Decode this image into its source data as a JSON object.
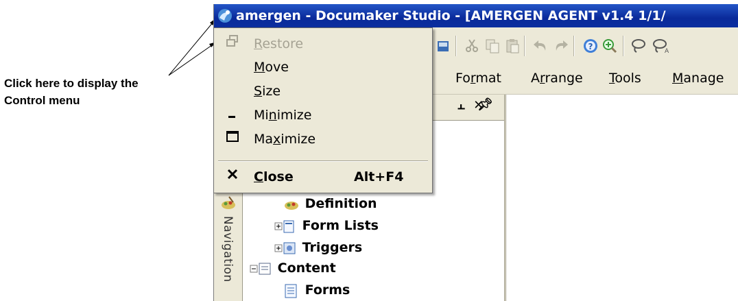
{
  "callout": {
    "line1": "Click here to display the",
    "line2": "Control menu"
  },
  "window": {
    "title": "amergen - Documaker Studio - [AMERGEN AGENT v1.4 1/1/",
    "icon": "app-icon"
  },
  "menubar": {
    "items": [
      {
        "pre": "Fo",
        "ul": "r",
        "post": "mat"
      },
      {
        "pre": "A",
        "ul": "r",
        "post": "range"
      },
      {
        "pre": "",
        "ul": "T",
        "post": "ools"
      },
      {
        "pre": "",
        "ul": "M",
        "post": "anage"
      }
    ]
  },
  "panel": {
    "pin_close": "\u0004 ✕",
    "nav_label": "Navigation"
  },
  "tree": {
    "items": [
      {
        "label": "Definition"
      },
      {
        "label": "Form Lists"
      },
      {
        "label": "Triggers"
      },
      {
        "label": "Content"
      },
      {
        "label": "Forms"
      }
    ]
  },
  "control_menu": {
    "restore": {
      "pre": "",
      "ul": "R",
      "post": "estore"
    },
    "move": {
      "pre": "",
      "ul": "M",
      "post": "ove"
    },
    "size": {
      "pre": "",
      "ul": "S",
      "post": "ize"
    },
    "minimize": {
      "pre": "Mi",
      "ul": "n",
      "post": "imize"
    },
    "maximize": {
      "pre": "Ma",
      "ul": "x",
      "post": "imize"
    },
    "close": {
      "pre": "",
      "ul": "C",
      "post": "lose"
    },
    "close_shortcut": "Alt+F4"
  },
  "colors": {
    "title_bar": "#0a2a9a",
    "face": "#ece9d8",
    "disabled_text": "#a5a293"
  }
}
